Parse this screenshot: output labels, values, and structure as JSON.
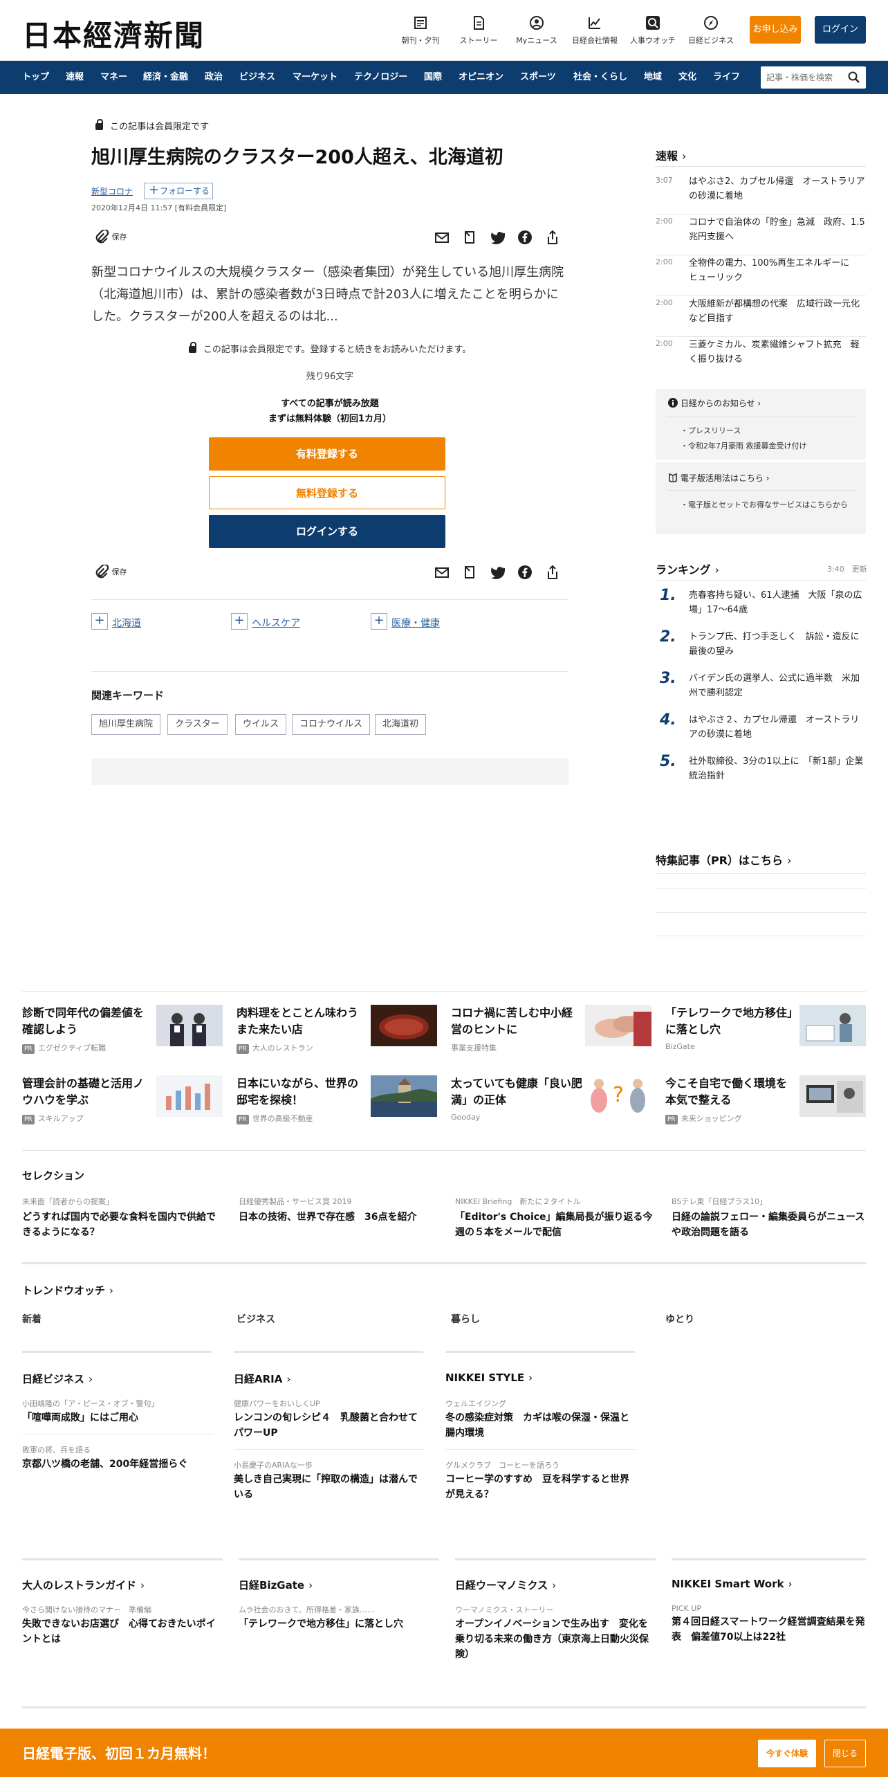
{
  "header": {
    "logo": "日本經濟新聞",
    "icons": [
      {
        "label": "朝刊・夕刊",
        "icon": "newspaper-icon"
      },
      {
        "label": "ストーリー",
        "icon": "document-icon"
      },
      {
        "label": "Myニュース",
        "icon": "person-icon"
      },
      {
        "label": "日経会社情報",
        "icon": "chart-icon"
      },
      {
        "label": "人事ウオッチ",
        "icon": "magnifier-icon"
      },
      {
        "label": "日経ビジネス",
        "icon": "compass-icon"
      }
    ],
    "subscribe_label": "お申し込み",
    "login_label": "ログイン"
  },
  "nav": {
    "items": [
      "トップ",
      "速報",
      "マネー",
      "経済・金融",
      "政治",
      "ビジネス",
      "マーケット",
      "テクノロジー",
      "国際",
      "オピニオン",
      "スポーツ",
      "社会・くらし",
      "地域",
      "文化",
      "ライフ"
    ],
    "search_placeholder": "記事・株価を検索"
  },
  "article": {
    "members_only": "この記事は会員限定です",
    "title": "旭川厚生病院のクラスター200人超え、北海道初",
    "tag": "新型コロナ",
    "follow_label": "フォローする",
    "date": "2020年12月4日 11:57 [有料会員限定]",
    "save_label": "保存",
    "body": "新型コロナウイルスの大規模クラスター（感染者集団）が発生している旭川厚生病院（北海道旭川市）は、累計の感染者数が3日時点で計203人に増えたことを明らかにした。クラスターが200人を超えるのは北...",
    "paywall_notice": "この記事は会員限定です。登録すると続きをお読みいただけます。",
    "remaining": "残り96文字",
    "offer_line1": "すべての記事が読み放題",
    "offer_line2": "まずは無料体験（初回1カ月）",
    "paid_register": "有料登録する",
    "free_register": "無料登録する",
    "login": "ログインする",
    "topics": [
      "北海道",
      "ヘルスケア",
      "医療・健康"
    ],
    "keywords_heading": "関連キーワード",
    "keywords": [
      "旭川厚生病院",
      "クラスター",
      "ウイルス",
      "コロナウイルス",
      "北海道初"
    ]
  },
  "sidebar": {
    "sokuho_heading": "速報",
    "sokuho": [
      {
        "time": "3:07",
        "title": "はやぶさ2、カプセル帰還　オーストラリアの砂漠に着地"
      },
      {
        "time": "2:00",
        "title": "コロナで自治体の「貯金」急減　政府、1.5兆円支援へ"
      },
      {
        "time": "2:00",
        "title": "全物件の電力、100%再生エネルギーに　ヒューリック"
      },
      {
        "time": "2:00",
        "title": "大阪維新が都構想の代案　広域行政一元化など目指す"
      },
      {
        "time": "2:00",
        "title": "三菱ケミカル、炭素繊維シャフト拡充　軽く振り抜ける"
      }
    ],
    "notice_heading": "日経からのお知らせ",
    "notice_items": [
      "プレスリリース",
      "令和2年7月豪雨 救援募金受け付け"
    ],
    "digital_heading": "電子版活用法はこちら",
    "digital_items": [
      "電子版とセットでお得なサービスはこちらから"
    ],
    "ranking_heading": "ランキング",
    "ranking_time": "3:40",
    "ranking_update": "更新",
    "ranking": [
      {
        "rank": "1.",
        "title": "売春客持ち疑い、61人逮捕　大阪「泉の広場」17～64歳"
      },
      {
        "rank": "2.",
        "title": "トランプ氏、打つ手乏しく　訴訟・造反に最後の望み"
      },
      {
        "rank": "3.",
        "title": "バイデン氏の選挙人、公式に過半数　米加州で勝利認定"
      },
      {
        "rank": "4.",
        "title": "はやぶさ２、カプセル帰還　オーストラリアの砂漠に着地"
      },
      {
        "rank": "5.",
        "title": "社外取締役、3分の1以上に　「新1部」企業統治指針"
      }
    ],
    "pr_heading": "特集記事（PR）はこちら"
  },
  "ads": [
    {
      "title": "診断で同年代の偏差値を確認しよう",
      "source": "エグゼクティブ転職",
      "pr": true
    },
    {
      "title": "肉料理をとことん味わう　また来たい店",
      "source": "大人のレストラン",
      "pr": true
    },
    {
      "title": "コロナ禍に苦しむ中小経営のヒントに",
      "source": "事業支援特集",
      "pr": false
    },
    {
      "title": "「テレワークで地方移住」に落とし穴",
      "source": "BizGate",
      "pr": false
    },
    {
      "title": "管理会計の基礎と活用ノウハウを学ぶ",
      "source": "スキルアップ",
      "pr": true
    },
    {
      "title": "日本にいながら、世界の邸宅を探検！",
      "source": "世界の高級不動産",
      "pr": true
    },
    {
      "title": "太っていても健康「良い肥満」の正体",
      "source": "Gooday",
      "pr": false
    },
    {
      "title": "今こそ自宅で働く環境を本気で整える",
      "source": "未来ショッピング",
      "pr": true
    }
  ],
  "selection": {
    "heading": "セレクション",
    "items": [
      {
        "kicker": "未来面「読者からの提案」",
        "title": "どうすれば国内で必要な食料を国内で供給できるようになる？"
      },
      {
        "kicker": "日経優秀製品・サービス賞 2019",
        "title": "日本の技術、世界で存在感　36点を紹介"
      },
      {
        "kicker": "NIKKEI Briefing　新たに２タイトル",
        "title": "「Editor's Choice」編集局長が振り返る今週の５本をメールで配信"
      },
      {
        "kicker": "BSテレ東「日経プラス10」",
        "title": "日経の論説フェロー・編集委員らがニュースや政治問題を語る"
      }
    ]
  },
  "trend": {
    "heading": "トレンドウオッチ",
    "tabs": [
      "新着",
      "ビジネス",
      "暮らし",
      "ゆとり"
    ]
  },
  "media": [
    {
      "heading": "日経ビジネス",
      "items": [
        {
          "kicker": "小田嶋隆の「ア・ピース・オブ・警句」",
          "title": "「喧嘩両成敗」にはご用心"
        },
        {
          "kicker": "敗軍の将、兵を語る",
          "title": "京都八ツ橋の老舗、200年経営揺らぐ"
        }
      ]
    },
    {
      "heading": "日経ARIA",
      "items": [
        {
          "kicker": "健康パワーをおいしくUP",
          "title": "レンコンの旬レシピ４　乳酸菌と合わせてパワーUP"
        },
        {
          "kicker": "小島慶子のARIAな一歩",
          "title": "美しき自己実現に「搾取の構造」は潜んでいる"
        }
      ]
    },
    {
      "heading": "NIKKEI STYLE",
      "items": [
        {
          "kicker": "ウェルエイジング",
          "title": "冬の感染症対策　カギは喉の保湿・保温と腸内環境"
        },
        {
          "kicker": "グルメクラブ　コーヒーを語ろう",
          "title": "コーヒー学のすすめ　豆を科学すると世界が見える？"
        }
      ]
    }
  ],
  "media2": [
    {
      "heading": "大人のレストランガイド",
      "kicker": "今さら聞けない接待のマナー　準備編",
      "title": "失敗できないお店選び　心得ておきたいポイントとは"
    },
    {
      "heading": "日経BizGate",
      "kicker": "ムラ社会のおきて、所得格差・家族……",
      "title": "「テレワークで地方移住」に落とし穴"
    },
    {
      "heading": "日経ウーマノミクス",
      "kicker": "ウーマノミクス・ストーリー",
      "title": "オープンイノベーションで生み出す　変化を乗り切る未来の働き方（東京海上日動火災保険）"
    },
    {
      "heading": "NIKKEI Smart Work",
      "kicker": "PICK UP",
      "title": "第４回日経スマートワーク経営調査結果を発表　偏差値70以上は22社"
    }
  ],
  "footer": {
    "promo": "日経電子版、初回１カ月無料！",
    "try_label": "今すぐ体験",
    "close_label": "閉じる"
  },
  "colors": {
    "navy": "#0d3c6e",
    "orange": "#f08300",
    "link": "#2a5f9e"
  }
}
